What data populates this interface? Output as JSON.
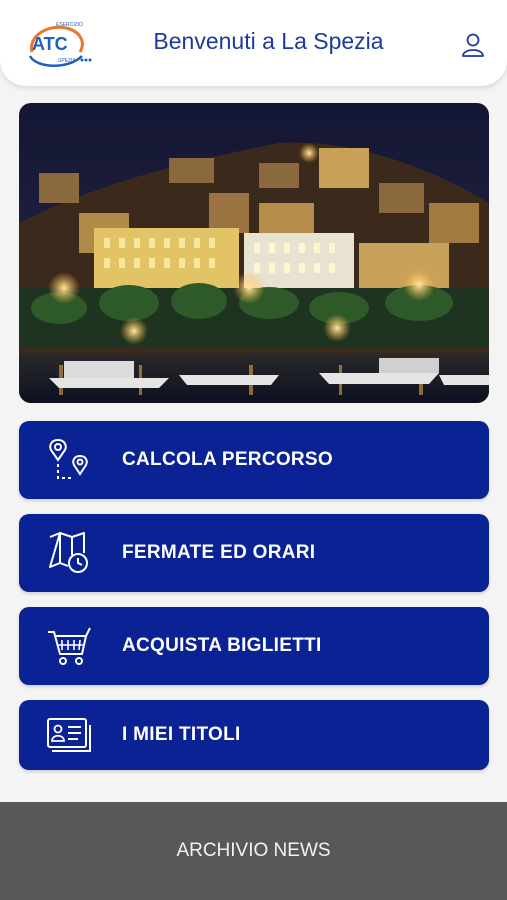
{
  "header": {
    "logo": {
      "text": "ATC",
      "small_top": "ESERCIZIO",
      "small_bottom": "SPEZIA"
    },
    "title": "Benvenuti a La Spezia",
    "user_icon": "user-icon"
  },
  "hero": {
    "description_icon": "city-night-photo"
  },
  "menu": [
    {
      "label": "CALCOLA PERCORSO",
      "icon": "route-pins-icon"
    },
    {
      "label": "FERMATE ED ORARI",
      "icon": "map-clock-icon"
    },
    {
      "label": "ACQUISTA BIGLIETTI",
      "icon": "cart-icon"
    },
    {
      "label": "I MIEI TITOLI",
      "icon": "id-card-icon"
    }
  ],
  "footer": {
    "label": "ARCHIVIO NEWS"
  },
  "colors": {
    "primary": "#0a2293",
    "title": "#1e3a9a",
    "footer": "#585858",
    "logo_orange": "#e8762c"
  }
}
